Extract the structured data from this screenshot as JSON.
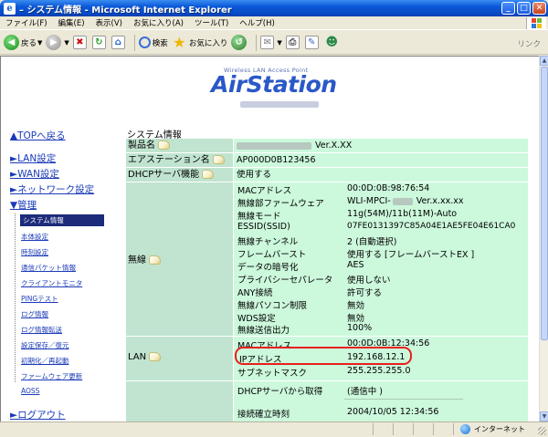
{
  "window": {
    "title": "– システム情報 - Microsoft Internet Explorer",
    "minimize": "_",
    "maximize": "□",
    "close": "✕"
  },
  "menu": [
    "ファイル(F)",
    "編集(E)",
    "表示(V)",
    "お気に入り(A)",
    "ツール(T)",
    "ヘルプ(H)"
  ],
  "toolbar": {
    "back_label": "戻る",
    "search_label": "検索",
    "favorites_label": "お気に入り",
    "links_label": "リンク"
  },
  "logo": {
    "tagline": "Wireless LAN Access Point",
    "brand": "AirStation"
  },
  "nav": {
    "top": "▲TOPへ戻る",
    "lan": "►LAN設定",
    "wan": "►WAN設定",
    "network": "►ネットワーク設定",
    "admin": "▼管理",
    "admin_items": [
      "システム情報",
      "本体設定",
      "時刻設定",
      "通信パケット情報",
      "クライアントモニタ",
      "PINGテスト",
      "ログ情報",
      "ログ情報転送",
      "設定保存／復元",
      "初期化／再起動",
      "ファームウェア更新",
      "AOSS"
    ],
    "logout": "►ログアウト"
  },
  "main": {
    "title": "システム情報",
    "product_label": "製品名",
    "product_value": "Ver.X.XX",
    "airstation_label": "エアステーション名",
    "airstation_value": "AP000D0B123456",
    "dhcp_label": "DHCPサーバ機能",
    "dhcp_value": "使用する",
    "wireless": {
      "label": "無線",
      "rows": [
        {
          "k": "MACアドレス",
          "v": "00:0D:0B:98:76:54"
        },
        {
          "k": "無線部ファームウェア",
          "v": "WLI-MPCI-",
          "v2": "Ver.x.xx.xx"
        },
        {
          "k": "無線モード",
          "v": "11g(54M)/11b(11M)-Auto"
        },
        {
          "k": "ESSID(SSID)",
          "v": "07FE0131397C85A04E1AE5FE04E61CA0"
        },
        {
          "k": "無線チャンネル",
          "v": "2 (自動選択)"
        },
        {
          "k": "フレームバースト",
          "v": "使用する [フレームバーストEX ]"
        },
        {
          "k": "データの暗号化",
          "v": "AES"
        },
        {
          "k": "プライバシーセパレータ",
          "v": "使用しない"
        },
        {
          "k": "ANY接続",
          "v": "許可する"
        },
        {
          "k": "無線パソコン制限",
          "v": "無効"
        },
        {
          "k": "WDS設定",
          "v": "無効"
        },
        {
          "k": "無線送信出力",
          "v": "100%"
        }
      ]
    },
    "lan": {
      "label": "LAN",
      "rows": [
        {
          "k": "MACアドレス",
          "v": "00:0D:0B:12:34:56"
        },
        {
          "k": "IPアドレス",
          "v": "192.168.12.1"
        },
        {
          "k": "サブネットマスク",
          "v": "255.255.255.0"
        }
      ]
    },
    "wan": {
      "rows": [
        {
          "k": "DHCPサーバから取得",
          "v": "(通信中 )"
        },
        {
          "k": "接続確立時刻",
          "v": "2004/10/05 12:34:56"
        }
      ]
    }
  },
  "status": {
    "zone": "インターネット"
  }
}
